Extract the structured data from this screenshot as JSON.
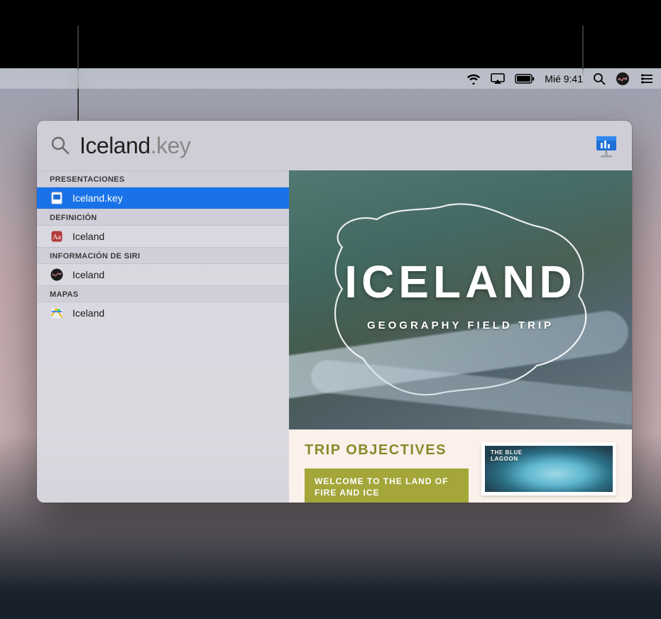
{
  "menubar": {
    "clock": "Mié 9:41"
  },
  "spotlight": {
    "query_base": "Iceland",
    "query_ext": ".key",
    "categories": [
      {
        "label": "PRESENTACIONES",
        "items": [
          {
            "label": "Iceland.key",
            "icon": "keynote-doc-icon",
            "selected": true
          }
        ]
      },
      {
        "label": "DEFINICIÓN",
        "items": [
          {
            "label": "Iceland",
            "icon": "dictionary-icon",
            "selected": false
          }
        ]
      },
      {
        "label": "INFORMACIÓN DE SIRI",
        "items": [
          {
            "label": "Iceland",
            "icon": "siri-knowledge-icon",
            "selected": false
          }
        ]
      },
      {
        "label": "MAPAS",
        "items": [
          {
            "label": "Iceland",
            "icon": "maps-icon",
            "selected": false
          }
        ]
      }
    ]
  },
  "preview": {
    "slide1_title": "ICELAND",
    "slide1_subtitle": "GEOGRAPHY FIELD TRIP",
    "slide2_heading": "TRIP OBJECTIVES",
    "slide2_bar_line1": "WELCOME TO THE LAND OF",
    "slide2_bar_line2": "FIRE AND ICE",
    "thumb_label_line1": "THE BLUE",
    "thumb_label_line2": "LAGOON"
  }
}
